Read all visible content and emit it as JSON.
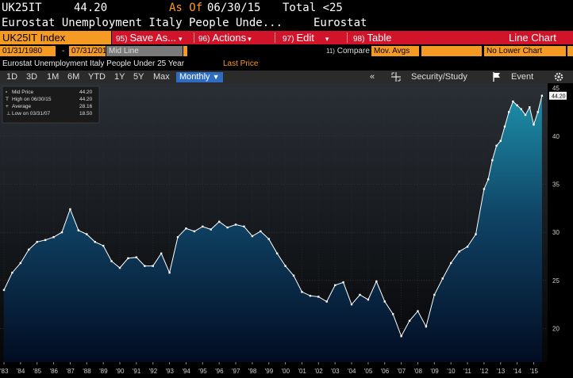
{
  "header": {
    "ticker": "UK25IT",
    "price": "44.20",
    "asof_label": "As Of",
    "asof_date": "06/30/15",
    "total": "Total <25",
    "description": "Eurostat Unemployment Italy People Unde...",
    "source": "Eurostat"
  },
  "toolbar": {
    "index_label": "UK25IT Index",
    "buttons": [
      {
        "num": "95)",
        "label": "Save As...",
        "arrow": "▾"
      },
      {
        "num": "96)",
        "label": "Actions",
        "arrow": "▾"
      },
      {
        "num": "97)",
        "label": "Edit",
        "arrow": "▾"
      },
      {
        "num": "98)",
        "label": "Table",
        "arrow": ""
      }
    ],
    "chart_type": "Line Chart"
  },
  "daterow": {
    "start": "01/31/1980",
    "dash": "-",
    "end": "07/31/2015",
    "mode": "Mid Line",
    "compare_num": "11)",
    "compare_label": "Compare",
    "compare_value": "Mov. Avgs",
    "lower_chart": "No Lower Chart"
  },
  "subtitle": {
    "series": "Eurostat Unemployment Italy People Under 25 Year",
    "field": "Last Price"
  },
  "periods": [
    "1D",
    "3D",
    "1M",
    "6M",
    "YTD",
    "1Y",
    "5Y",
    "Max"
  ],
  "period_active": "Monthly",
  "period_arrow": "▼",
  "rightbar": {
    "collapse": "«",
    "security_study": "Security/Study",
    "event": "Event"
  },
  "colors": {
    "orange": "#f59a23",
    "red": "#d2142a",
    "active_blue": "#2e6cc4"
  },
  "chart_data": {
    "type": "area",
    "legend": [
      {
        "label": "Mid Price",
        "value": "44.20"
      },
      {
        "label": "High on 06/30/15",
        "value": "44.20"
      },
      {
        "label": "Average",
        "value": "28.16"
      },
      {
        "label": "Low on 03/31/07",
        "value": "18.50"
      }
    ],
    "last_value_label": "44.20",
    "yticks": [
      20,
      25,
      30,
      35,
      40,
      45
    ],
    "ylim": [
      16.5,
      45.5
    ],
    "xticks": [
      "'83",
      "'84",
      "'85",
      "'86",
      "'87",
      "'88",
      "'89",
      "'90",
      "'91",
      "'92",
      "'93",
      "'94",
      "'95",
      "'96",
      "'97",
      "'98",
      "'99",
      "'00",
      "'01",
      "'02",
      "'03",
      "'04",
      "'05",
      "'06",
      "'07",
      "'08",
      "'09",
      "'10",
      "'11",
      "'12",
      "'13",
      "'14",
      "'15"
    ],
    "xlim": [
      1983.0,
      2015.6
    ],
    "x": [
      1983.0,
      1983.5,
      1984.0,
      1984.5,
      1985.0,
      1985.5,
      1986.0,
      1986.5,
      1987.0,
      1987.5,
      1988.0,
      1988.5,
      1989.0,
      1989.5,
      1990.0,
      1990.5,
      1991.0,
      1991.5,
      1992.0,
      1992.5,
      1993.0,
      1993.5,
      1994.0,
      1994.5,
      1995.0,
      1995.5,
      1996.0,
      1996.5,
      1997.0,
      1997.5,
      1998.0,
      1998.5,
      1999.0,
      1999.5,
      2000.0,
      2000.5,
      2001.0,
      2001.5,
      2002.0,
      2002.5,
      2003.0,
      2003.5,
      2004.0,
      2004.5,
      2005.0,
      2005.5,
      2006.0,
      2006.5,
      2007.0,
      2007.5,
      2008.0,
      2008.5,
      2009.0,
      2009.5,
      2010.0,
      2010.5,
      2011.0,
      2011.5,
      2012.0,
      2012.25,
      2012.5,
      2012.75,
      2013.0,
      2013.25,
      2013.5,
      2013.75,
      2014.0,
      2014.25,
      2014.5,
      2014.75,
      2015.0,
      2015.25,
      2015.5
    ],
    "y": [
      24.0,
      25.8,
      26.8,
      28.2,
      29.0,
      29.2,
      29.5,
      30.0,
      32.4,
      30.2,
      29.8,
      29.0,
      28.6,
      27.0,
      26.3,
      27.3,
      27.4,
      26.5,
      26.5,
      27.8,
      25.8,
      29.5,
      30.4,
      30.1,
      30.6,
      30.3,
      31.1,
      30.5,
      30.8,
      30.6,
      29.6,
      30.1,
      29.3,
      27.8,
      26.5,
      25.5,
      23.8,
      23.4,
      23.3,
      22.8,
      24.5,
      24.8,
      22.5,
      23.5,
      23.0,
      24.9,
      22.8,
      21.5,
      19.2,
      20.8,
      21.8,
      20.2,
      23.5,
      25.2,
      26.8,
      28.0,
      28.5,
      29.8,
      34.5,
      35.5,
      37.5,
      39.0,
      39.5,
      41.0,
      42.5,
      43.6,
      43.2,
      42.8,
      42.2,
      43.0,
      41.2,
      42.5,
      44.2
    ]
  }
}
